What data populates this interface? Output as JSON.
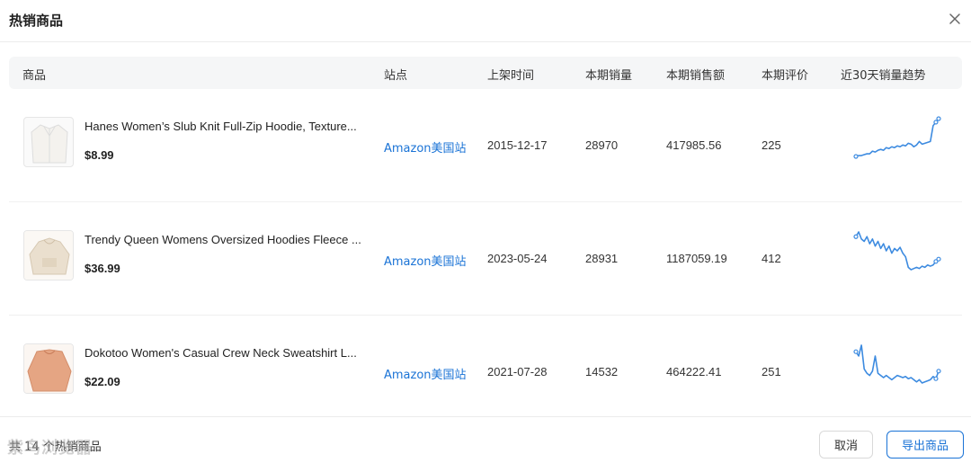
{
  "dialog": {
    "title": "热销商品"
  },
  "table": {
    "headers": {
      "product": "商品",
      "site": "站点",
      "listed": "上架时间",
      "sales": "本期销量",
      "revenue": "本期销售额",
      "reviews": "本期评价",
      "trend": "近30天销量趋势"
    },
    "rows": [
      {
        "name": "Hanes Women’s Slub Knit Full-Zip Hoodie, Texture...",
        "price": "$8.99",
        "site": "Amazon美国站",
        "listed": "2015-12-17",
        "sales": "28970",
        "revenue": "417985.56",
        "reviews": "225",
        "trend": [
          5,
          6,
          6,
          7,
          8,
          8,
          11,
          10,
          12,
          13,
          12,
          15,
          14,
          16,
          15,
          17,
          16,
          18,
          17,
          20,
          19,
          16,
          18,
          22,
          19,
          20,
          21,
          22,
          40,
          44,
          48
        ]
      },
      {
        "name": "Trendy Queen Womens Oversized Hoodies Fleece ...",
        "price": "$36.99",
        "site": "Amazon美国站",
        "listed": "2023-05-24",
        "sales": "28931",
        "revenue": "1187059.19",
        "reviews": "412",
        "trend": [
          42,
          46,
          40,
          38,
          42,
          36,
          40,
          34,
          38,
          32,
          36,
          30,
          34,
          28,
          32,
          30,
          33,
          28,
          25,
          16,
          14,
          15,
          16,
          15,
          17,
          16,
          18,
          17,
          18,
          21,
          23
        ]
      },
      {
        "name": "Dokotoo Women's Casual Crew Neck Sweatshirt L...",
        "price": "$22.09",
        "site": "Amazon美国站",
        "listed": "2021-07-28",
        "sales": "14532",
        "revenue": "464222.41",
        "reviews": "251",
        "trend": [
          38,
          34,
          44,
          22,
          18,
          16,
          20,
          34,
          18,
          16,
          14,
          16,
          14,
          12,
          14,
          16,
          15,
          14,
          15,
          13,
          14,
          12,
          10,
          12,
          9,
          10,
          11,
          12,
          15,
          13,
          20
        ]
      }
    ]
  },
  "footer": {
    "total": "共 14 个热销商品",
    "watermark": "紫鸟浏览器",
    "cancel": "取消",
    "export": "导出商品"
  },
  "colors": {
    "accent": "#1a73d6",
    "trend_line": "#3d8be0"
  }
}
